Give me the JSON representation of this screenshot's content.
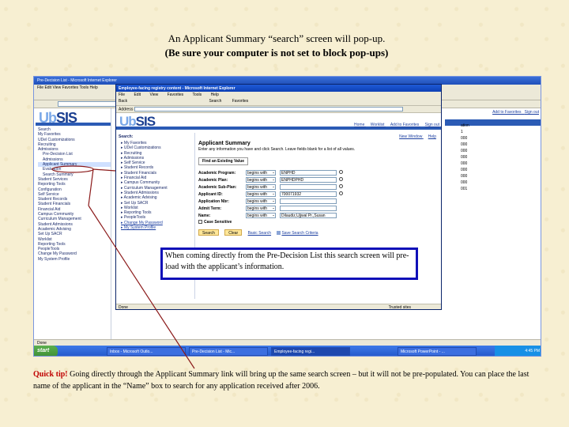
{
  "heading": {
    "line1": "An Applicant Summary “search” screen will pop-up.",
    "line2": "(Be sure your computer is not set to block pop-ups)"
  },
  "outer_window": {
    "title": "Pre-Decision List - Microsoft Internet Explorer",
    "menu": "File  Edit  View  Favorites  Tools  Help",
    "logo_prefix": "Ub",
    "logo_mid": "SIS",
    "tree": [
      "Search",
      "My Favorites",
      "UDel Customizations",
      "Recruiting",
      "Admissions",
      "Pre-Decision List",
      "Admissions",
      "Applicant Summary",
      "Evaluation",
      "Search Summary",
      "Student Services",
      "Reporting Tools",
      "Configuration",
      "Self Service",
      "Student Records",
      "Student Financials",
      "Financial Aid",
      "Campus Community",
      "Curriculum Management",
      "Student Admissions",
      "Academic Advising",
      "Set Up SACR",
      "Worklist",
      "Reporting Tools",
      "PeopleTools",
      "Change My Password",
      "My System Profile"
    ],
    "right_links": [
      "Add to Favorites",
      "Sign out"
    ],
    "right_col": [
      "ation",
      "1",
      "000",
      "000",
      "000",
      "000",
      "000",
      "000",
      "000",
      "000",
      "001"
    ],
    "status": "Done",
    "taskbar": {
      "start": "start",
      "tasks": [
        "Inbox - Microsoft Outlo...",
        "Pre-Decision List - Mic...",
        "Employee-facing regi...",
        "Microsoft PowerPoint - ..."
      ],
      "tray": "4:45 PM"
    }
  },
  "popup": {
    "title": "Employee-facing registry content - Microsoft Internet Explorer",
    "menu": [
      "File",
      "Edit",
      "View",
      "Favorites",
      "Tools",
      "Help"
    ],
    "toolbar": [
      "Back",
      "Search",
      "Favorites"
    ],
    "address_label": "Address",
    "logo_prefix": "Ub",
    "logo_mid": "SIS",
    "nav_links": [
      "Home",
      "Worklist",
      "Add to Favorites",
      "Sign out"
    ],
    "search_label": "Search:",
    "menu_items": [
      "My Favorites",
      "UDel Customizations",
      "Recruiting",
      "Admissions",
      "Self Service",
      "Student Records",
      "Student Financials",
      "Financial Aid",
      "Campus Community",
      "Curriculum Management",
      "Student Admissions",
      "Academic Advising",
      "Set Up SACR",
      "Worklist",
      "Reporting Tools",
      "PeopleTools",
      "Change My Password",
      "My System Profile"
    ],
    "main": {
      "links": [
        "New Window",
        "Help"
      ],
      "heading": "Applicant Summary",
      "instructions": "Enter any information you have and click Search. Leave fields blank for a list of all values.",
      "find_tab": "Find an Existing Value",
      "fields": [
        {
          "label": "Academic Program:",
          "op": "begins with",
          "value": "ENPHD"
        },
        {
          "label": "Academic Plan:",
          "op": "begins with",
          "value": "ENPHDPHD"
        },
        {
          "label": "Academic Sub-Plan:",
          "op": "begins with",
          "value": ""
        },
        {
          "label": "Applicant ID:",
          "op": "begins with",
          "value": "700071932"
        },
        {
          "label": "Application Nbr:",
          "op": "begins with",
          "value": ""
        },
        {
          "label": "Admit Term:",
          "op": "begins with",
          "value": ""
        },
        {
          "label": "Name:",
          "op": "begins with",
          "value": "Dilaudiz,Ujjwal Pr.,Susan"
        }
      ],
      "case_sensitive": "Case Sensitive",
      "buttons": {
        "search": "Search",
        "clear": "Clear"
      },
      "basic_search": "Basic Search",
      "save_criteria": "Save Search Criteria"
    },
    "status": "Done",
    "status_right": "Trusted sites"
  },
  "callout": "When coming directly from the Pre-Decision List this search screen will pre-load with the applicant’s information.",
  "tip": {
    "label": "Quick tip!",
    "text": "Going directly through the Applicant Summary link will bring up the same search screen – but it will not be pre-populated.  You can place the last name of the applicant in the “Name” box to search for any application received after 2006."
  },
  "colors": {
    "background": "#f7efd2",
    "callout_border": "#1010b8",
    "arrow": "#8b1a1a",
    "tip_label": "#c00000",
    "accent_blue": "#2b5bb5"
  }
}
